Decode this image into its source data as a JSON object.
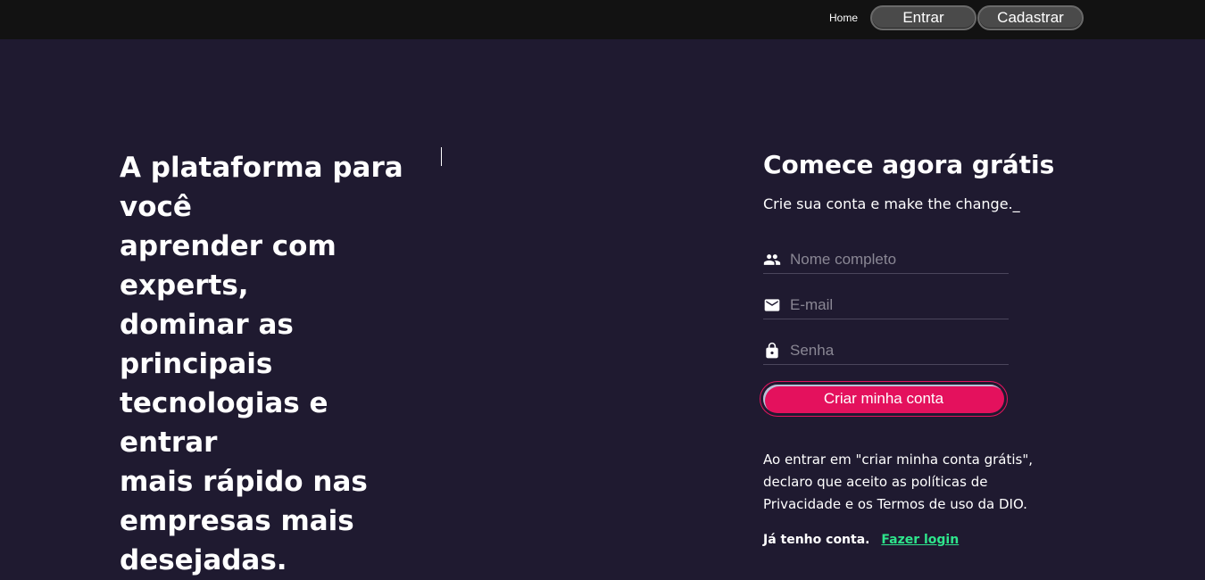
{
  "nav": {
    "home": "Home",
    "login_button": "Entrar",
    "signup_button": "Cadastrar"
  },
  "hero": {
    "lines": [
      "A plataforma para",
      "você",
      "aprender com",
      "experts,",
      "dominar as",
      "principais",
      "tecnologias e entrar",
      "mais rápido nas",
      "empresas mais",
      "desejadas."
    ]
  },
  "form": {
    "title": "Comece agora grátis",
    "subtitle": "Crie sua conta e make the change._",
    "name_placeholder": "Nome completo",
    "email_placeholder": "E-mail",
    "password_placeholder": "Senha",
    "submit_label": "Criar minha conta",
    "terms_text": "Ao entrar em \"criar minha conta grátis\", declaro que aceito as políticas de Privacidade e os Termos de uso da DIO.",
    "have_account": "Já tenho conta.",
    "login_link": "Fazer login",
    "icons": {
      "name": "people-icon",
      "email": "mail-icon",
      "password": "lock-icon"
    }
  },
  "colors": {
    "background": "#1f1a30",
    "topbar": "#121212",
    "accent": "#e4115d",
    "link": "#2ee58c"
  }
}
